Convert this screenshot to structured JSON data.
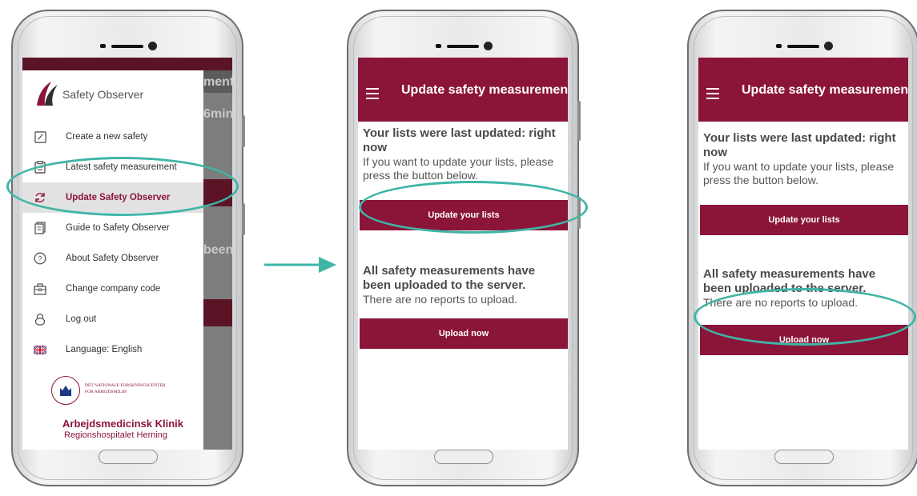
{
  "colors": {
    "brand": "#8b1538",
    "highlight": "#3fb5a6",
    "arrow": "#3fb5a6"
  },
  "drawer_screen": {
    "brand_name": "Safety Observer",
    "background_fragments": [
      "ment",
      "6min",
      "been"
    ],
    "menu": [
      {
        "label": "Create a new safety",
        "icon": "pencil-icon"
      },
      {
        "label": "Latest safety measurement",
        "icon": "clipboard-icon"
      },
      {
        "label": "Update Safety Observer",
        "icon": "refresh-icon",
        "active": true
      },
      {
        "label": "Guide to Safety Observer",
        "icon": "document-icon"
      },
      {
        "label": "About Safety Observer",
        "icon": "help-icon"
      },
      {
        "label": "Change company code",
        "icon": "briefcase-icon"
      },
      {
        "label": "Log out",
        "icon": "lock-icon"
      },
      {
        "label": "Language: English",
        "icon": "uk-flag-icon"
      }
    ],
    "footer": {
      "nfa_line1": "DET NATIONALE FORSKNINGSCENTER",
      "nfa_line2": "FOR ARBEJDSMILJØ",
      "crest_ring": "FORSKNINGSCENTER FOR ARBEJDSMILJØ",
      "clinic": "Arbejdsmedicinsk Klinik",
      "hospital": "Regionshospitalet Herning"
    }
  },
  "update_screen": {
    "title": "Update safety measurement",
    "lists_heading": "Your lists were last updated: right now",
    "lists_text": "If you want to update your lists, please press the button below.",
    "update_button": "Update your lists",
    "upload_heading": "All safety measurements have been uploaded to the server.",
    "upload_text": "There are no reports to upload.",
    "upload_button": "Upload now"
  }
}
